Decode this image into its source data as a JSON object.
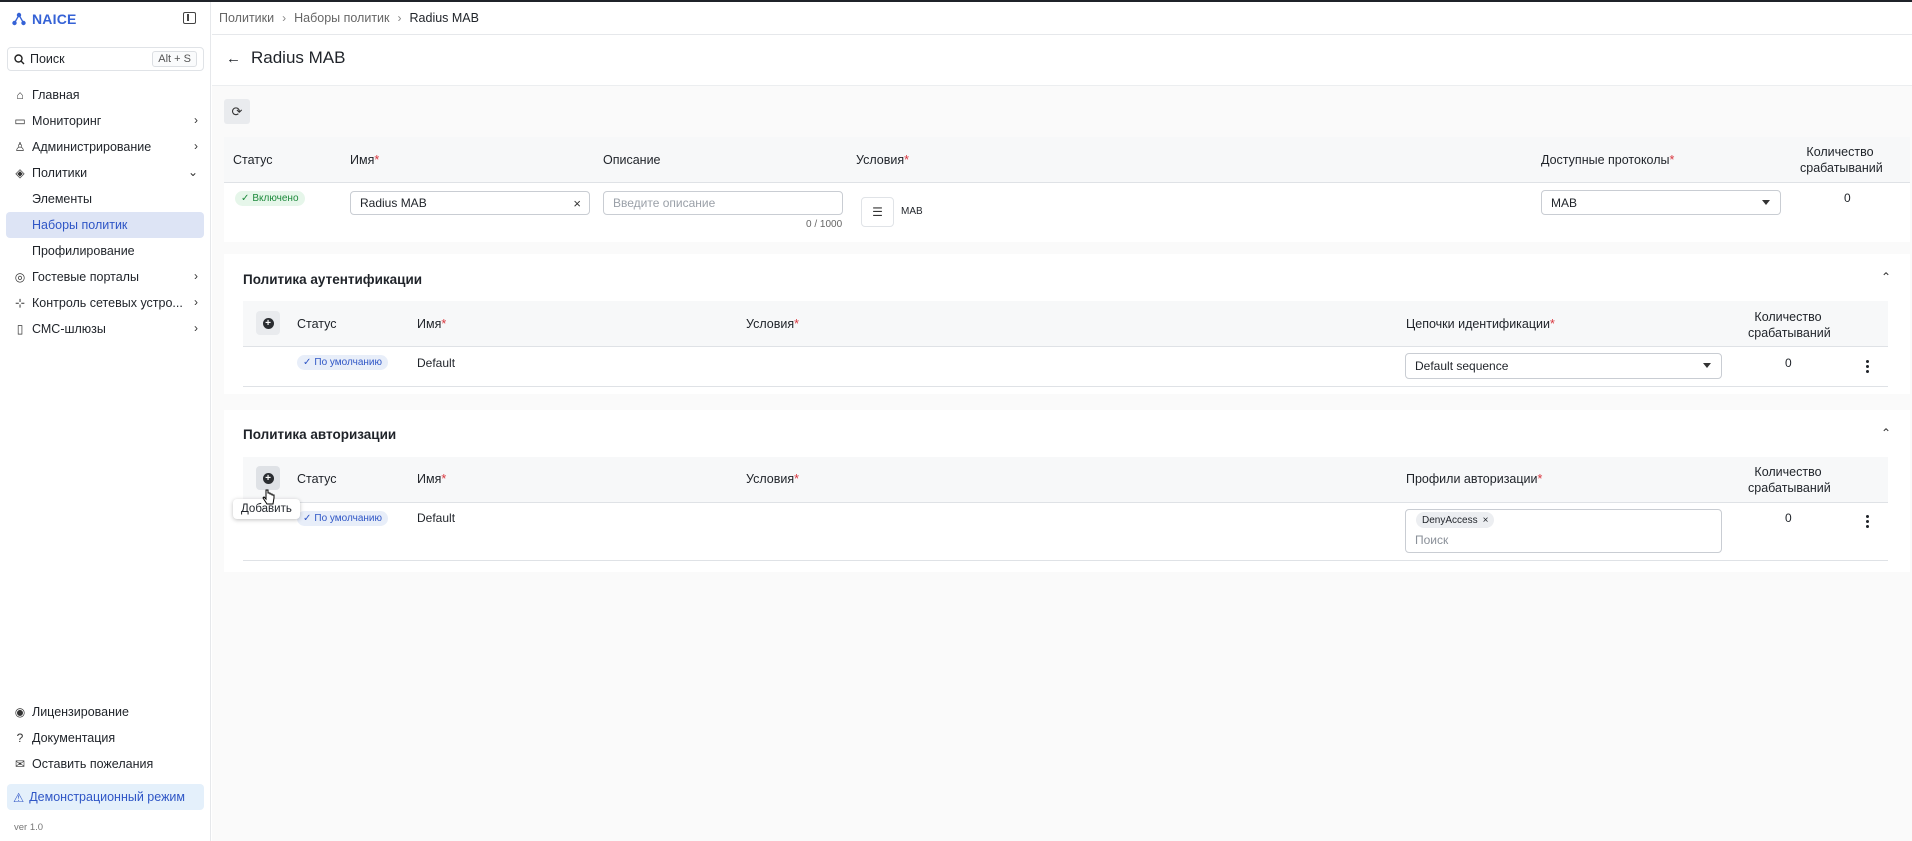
{
  "app": {
    "name": "NAICE",
    "version": "ver 1.0"
  },
  "search": {
    "label": "Поиск",
    "shortcut": "Alt + S"
  },
  "sidebar": {
    "items": [
      {
        "label": "Главная",
        "icon": "home-icon"
      },
      {
        "label": "Мониторинг",
        "icon": "monitor-icon"
      },
      {
        "label": "Администрирование",
        "icon": "user-icon"
      },
      {
        "label": "Политики",
        "icon": "shield-icon"
      },
      {
        "label": "Элементы"
      },
      {
        "label": "Наборы политик"
      },
      {
        "label": "Профилирование"
      },
      {
        "label": "Гостевые порталы",
        "icon": "wifi-icon"
      },
      {
        "label": "Контроль сетевых устро...",
        "icon": "network-icon"
      },
      {
        "label": "СМС-шлюзы",
        "icon": "sms-icon"
      }
    ],
    "bottom": [
      {
        "label": "Лицензирование",
        "icon": "license-icon"
      },
      {
        "label": "Документация",
        "icon": "help-icon"
      },
      {
        "label": "Оставить пожелания",
        "icon": "mail-icon"
      }
    ],
    "demo": "Демонстрационный режим"
  },
  "breadcrumb": [
    "Политики",
    "Наборы политик",
    "Radius MAB"
  ],
  "page_title": "Radius MAB",
  "policy_set": {
    "headers": {
      "status": "Статус",
      "name": "Имя",
      "description": "Описание",
      "conditions": "Условия",
      "protocols": "Доступные протоколы",
      "hits": "Количество срабатываний"
    },
    "status": "Включено",
    "name_value": "Radius MAB",
    "description_placeholder": "Введите описание",
    "description_counter": "0 / 1000",
    "condition": "MAB",
    "protocol": "MAB",
    "hits": "0"
  },
  "auth_policy": {
    "title": "Политика аутентификации",
    "headers": {
      "status": "Статус",
      "name": "Имя",
      "conditions": "Условия",
      "chains": "Цепочки идентификации",
      "hits": "Количество срабатываний"
    },
    "row": {
      "status": "По умолчанию",
      "name": "Default",
      "chain": "Default sequence",
      "hits": "0"
    }
  },
  "authz_policy": {
    "title": "Политика авторизации",
    "headers": {
      "status": "Статус",
      "name": "Имя",
      "conditions": "Условия",
      "profiles": "Профили авторизации",
      "hits": "Количество срабатываний"
    },
    "row": {
      "status": "По умолчанию",
      "name": "Default",
      "profile_tag": "DenyAccess",
      "search_placeholder": "Поиск",
      "hits": "0"
    }
  },
  "tooltip": "Добавить",
  "colors": {
    "accent": "#2f56c6",
    "enabled": "#1e8a3c",
    "required": "#d9363e"
  }
}
